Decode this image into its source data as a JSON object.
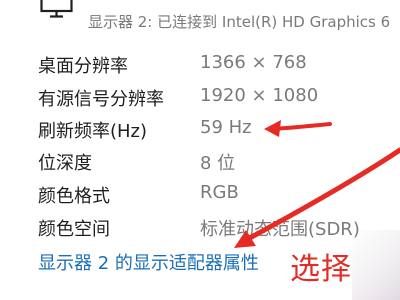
{
  "header": {
    "text": "显示器 2: 已连接到 Intel(R) HD Graphics 6"
  },
  "rows": [
    {
      "label": "桌面分辨率",
      "value": "1366 × 768"
    },
    {
      "label": "有源信号分辨率",
      "value": "1920 × 1080"
    },
    {
      "label": "刷新频率(Hz)",
      "value": "59 Hz"
    },
    {
      "label": "位深度",
      "value": "8 位"
    },
    {
      "label": "颜色格式",
      "value": "RGB"
    },
    {
      "label": "颜色空间",
      "value": "标准动态范围(SDR)"
    }
  ],
  "link": {
    "label": "显示器 2 的显示适配器属性"
  },
  "annotation": {
    "text": "选择",
    "color": "#e52b23"
  },
  "icons": {
    "monitor": "monitor-icon",
    "arrows": "red-arrow-icon"
  }
}
